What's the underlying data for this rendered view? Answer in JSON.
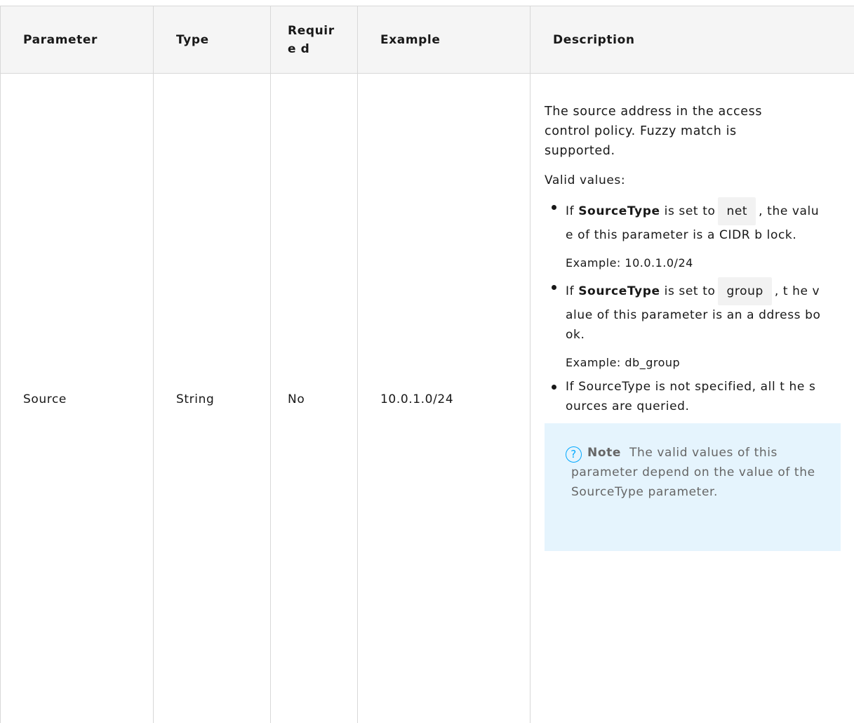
{
  "table": {
    "headers": {
      "parameter": "Parameter",
      "type": "Type",
      "required": "Require d",
      "example": "Example",
      "description": "Description"
    },
    "rows": [
      {
        "parameter": "Source",
        "type": "String",
        "required": "No",
        "example": "10.0.1.0/24",
        "description": {
          "intro": "The source address in the access control policy. Fuzzy match is supported.",
          "valid_values_label": "Valid values:",
          "options": [
            {
              "prefix": "If",
              "keyword": "SourceType",
              "middle": "is set to",
              "code": "net",
              "suffix": ", the value of this parameter is a CIDR b lock.",
              "example": "Example: 10.0.1.0/24"
            },
            {
              "prefix": "If",
              "keyword": "SourceType",
              "middle": "is set to",
              "code": "group",
              "suffix": ", t he value of this parameter is an a ddress book.",
              "example": "Example: db_group"
            },
            {
              "text": "If SourceType is not specified, all t he sources are queried."
            }
          ],
          "note": {
            "icon": "question-circle-icon",
            "label": "Note",
            "text": "The valid values of this parameter depend on the value of the SourceType parameter."
          }
        }
      }
    ]
  },
  "colors": {
    "header_bg": "#f5f5f5",
    "border": "#d8d8d8",
    "note_bg": "#e5f4fd",
    "note_icon": "#00a8ff",
    "code_bg": "#f2f2f2"
  }
}
